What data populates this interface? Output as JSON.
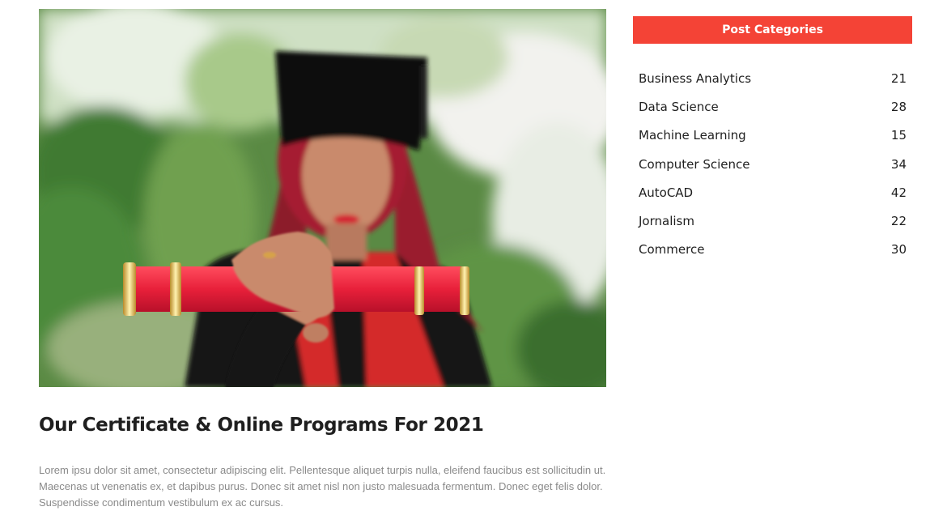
{
  "post": {
    "image_alt": "Graduate holding a red diploma",
    "title": "Our Certificate & Online Programs For 2021",
    "excerpt": "Lorem ipsu dolor sit amet, consectetur adipiscing elit. Pellentesque aliquet turpis nulla, eleifend faucibus est sollicitudin ut. Maecenas ut venenatis ex, et dapibus purus. Donec sit amet nisl non justo malesuada fermentum. Donec eget felis dolor. Suspendisse condimentum vestibulum ex ac cursus."
  },
  "sidebar": {
    "header": "Post Categories",
    "accent_color": "#f44336",
    "categories": [
      {
        "label": "Business Analytics",
        "count": "21"
      },
      {
        "label": "Data Science",
        "count": "28"
      },
      {
        "label": "Machine Learning",
        "count": "15"
      },
      {
        "label": "Computer Science",
        "count": "34"
      },
      {
        "label": "AutoCAD",
        "count": "42"
      },
      {
        "label": "Jornalism",
        "count": "22"
      },
      {
        "label": "Commerce",
        "count": "30"
      }
    ]
  }
}
